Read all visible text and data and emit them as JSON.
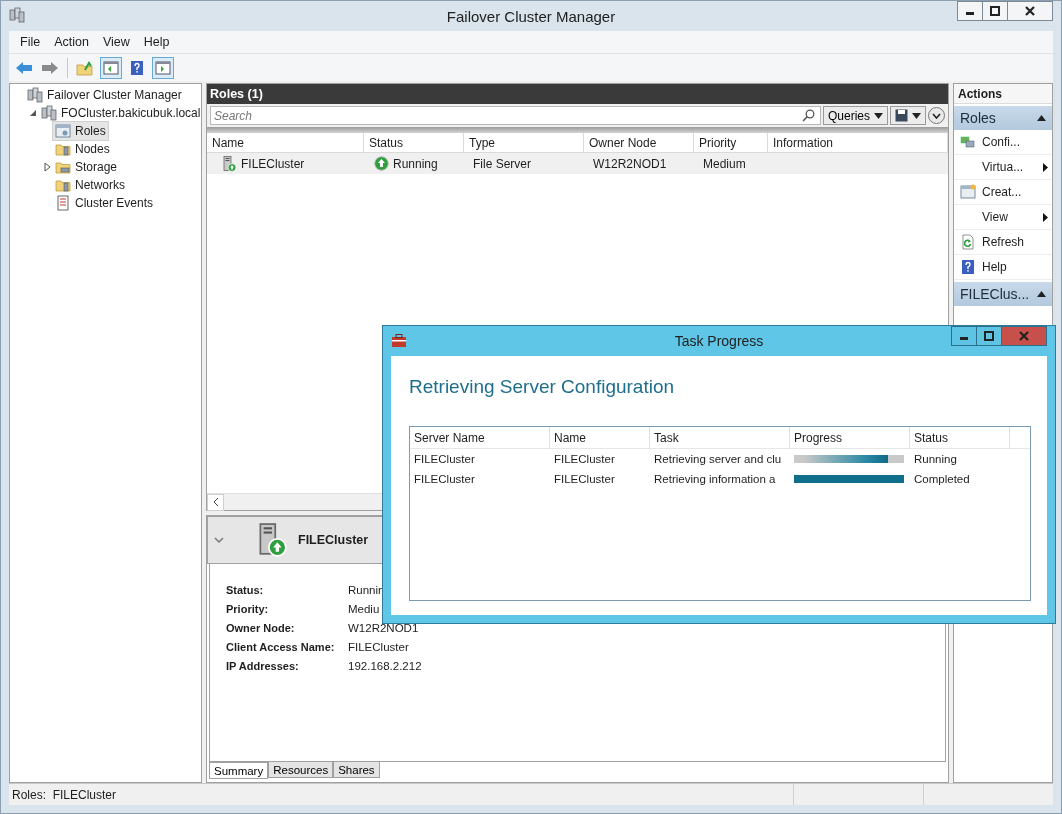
{
  "window": {
    "title": "Failover Cluster Manager"
  },
  "menu": [
    {
      "label": "File"
    },
    {
      "label": "Action"
    },
    {
      "label": "View"
    },
    {
      "label": "Help"
    }
  ],
  "tree": {
    "label": "Failover Cluster Manager",
    "kind": "manager",
    "selected": false,
    "children": [
      {
        "label": "FOCluster.bakicubuk.local",
        "kind": "cluster",
        "selected": false,
        "expanded": true,
        "children": [
          {
            "label": "Roles",
            "kind": "roles",
            "selected": true
          },
          {
            "label": "Nodes",
            "kind": "nodes",
            "selected": false
          },
          {
            "label": "Storage",
            "kind": "storage",
            "selected": false,
            "expanded": false
          },
          {
            "label": "Networks",
            "kind": "networks",
            "selected": false
          },
          {
            "label": "Cluster Events",
            "kind": "events",
            "selected": false
          }
        ]
      }
    ]
  },
  "roles": {
    "title": "Roles (1)",
    "search": {
      "placeholder": "Search"
    },
    "queries_button": "Queries",
    "columns": [
      "Name",
      "Status",
      "Type",
      "Owner Node",
      "Priority",
      "Information"
    ],
    "rows": [
      {
        "name": "FILECluster",
        "status": "Running",
        "type": "File Server",
        "owner_node": "W12R2NOD1",
        "priority": "Medium",
        "selected": true
      }
    ]
  },
  "details": {
    "title": "FILECluster",
    "expanded": true,
    "fields": [
      {
        "label": "Status:",
        "value": "Runnin"
      },
      {
        "label": "Priority:",
        "value": "Mediu"
      },
      {
        "label": "Owner Node:",
        "value": "W12R2NOD1"
      },
      {
        "label": "Client Access Name:",
        "value": "FILECluster"
      },
      {
        "label": "IP Addresses:",
        "value": "192.168.2.212"
      }
    ],
    "tabs": [
      {
        "label": "Summary",
        "selected": true
      },
      {
        "label": "Resources",
        "selected": false
      },
      {
        "label": "Shares",
        "selected": false
      }
    ]
  },
  "actions": {
    "title": "Actions",
    "sections": [
      {
        "title": "Roles",
        "expanded": true,
        "items": [
          {
            "label": "Confi...",
            "kind": "command"
          },
          {
            "label": "Virtua...",
            "kind": "submenu"
          },
          {
            "label": "Creat...",
            "kind": "command"
          },
          {
            "label": "View",
            "kind": "submenu"
          },
          {
            "label": "Refresh",
            "kind": "command"
          },
          {
            "label": "Help",
            "kind": "command"
          }
        ]
      },
      {
        "title": "FILEClus...",
        "expanded": true
      }
    ]
  },
  "status_bar": {
    "text": "Roles:  FILECluster"
  },
  "dialog": {
    "title": "Task Progress",
    "heading": "Retrieving Server Configuration",
    "columns": [
      "Server Name",
      "Name",
      "Task",
      "Progress",
      "Status"
    ],
    "rows": [
      {
        "server_name": "FILECluster",
        "name": "FILECluster",
        "task": "Retrieving server and clu",
        "level": 0.85,
        "status": "Running"
      },
      {
        "server_name": "FILECluster",
        "name": "FILECluster",
        "task": "Retrieving information a",
        "level": 1,
        "status": "Completed"
      }
    ]
  }
}
